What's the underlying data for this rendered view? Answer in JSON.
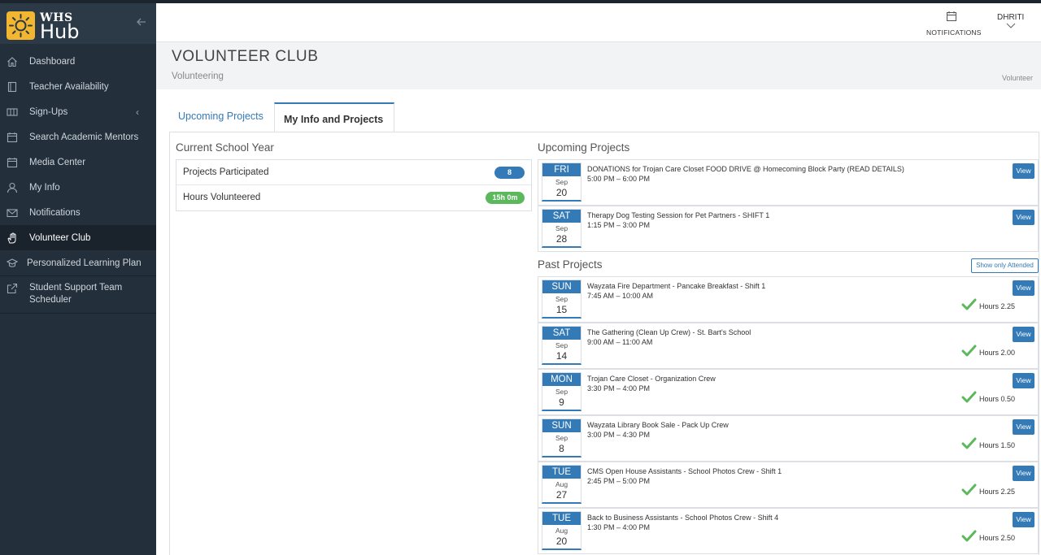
{
  "app": {
    "logo_top": "WHS",
    "logo_bottom": "Hub"
  },
  "sidebar": {
    "items": [
      {
        "label": "Dashboard",
        "icon": "home-icon"
      },
      {
        "label": "Teacher Availability",
        "icon": "book-icon"
      },
      {
        "label": "Sign-Ups",
        "icon": "columns-icon"
      },
      {
        "label": "Search Academic Mentors",
        "icon": "calendar-icon"
      },
      {
        "label": "Media Center",
        "icon": "calendar-icon"
      },
      {
        "label": "My Info",
        "icon": "user-icon"
      },
      {
        "label": "Notifications",
        "icon": "envelope-icon"
      },
      {
        "label": "Volunteer Club",
        "icon": "hand-icon"
      },
      {
        "label": "Personalized Learning Plan",
        "icon": "graduation-cap-icon"
      },
      {
        "label": "Student Support Team Scheduler",
        "icon": "external-link-icon"
      }
    ]
  },
  "header": {
    "notifications_label": "NOTIFICATIONS",
    "user_name": "DHRITI"
  },
  "page": {
    "title": "VOLUNTEER CLUB",
    "subtitle": "Volunteering",
    "breadcrumb": "Volunteer"
  },
  "tabs": [
    {
      "label": "Upcoming Projects"
    },
    {
      "label": "My Info and Projects"
    }
  ],
  "summary": {
    "title": "Current School Year",
    "rows": [
      {
        "label": "Projects Participated",
        "value": "8"
      },
      {
        "label": "Hours Volunteered",
        "value": "15h 0m"
      }
    ]
  },
  "upcoming": {
    "title": "Upcoming Projects",
    "items": [
      {
        "dow": "FRI",
        "mon": "Sep",
        "day": "20",
        "title": "DONATIONS for Trojan Care Closet FOOD DRIVE @ Homecoming Block Party (READ DETAILS)",
        "time": "5:00 PM – 6:00 PM",
        "view": "View"
      },
      {
        "dow": "SAT",
        "mon": "Sep",
        "day": "28",
        "title": "Therapy Dog Testing Session for Pet Partners - SHIFT 1",
        "time": "1:15 PM – 3:00 PM",
        "view": "View"
      }
    ]
  },
  "past": {
    "title": "Past Projects",
    "filter_label": "Show only Attended",
    "items": [
      {
        "dow": "SUN",
        "mon": "Sep",
        "day": "15",
        "title": "Wayzata Fire Department - Pancake Breakfast - Shift 1",
        "time": "7:45 AM – 10:00 AM",
        "hours": "Hours 2.25",
        "view": "View"
      },
      {
        "dow": "SAT",
        "mon": "Sep",
        "day": "14",
        "title": "The Gathering (Clean Up Crew) - St. Bart's School",
        "time": "9:00 AM – 11:00 AM",
        "hours": "Hours 2.00",
        "view": "View"
      },
      {
        "dow": "MON",
        "mon": "Sep",
        "day": "9",
        "title": "Trojan Care Closet - Organization Crew",
        "time": "3:30 PM – 4:00 PM",
        "hours": "Hours 0.50",
        "view": "View"
      },
      {
        "dow": "SUN",
        "mon": "Sep",
        "day": "8",
        "title": "Wayzata Library Book Sale - Pack Up Crew",
        "time": "3:00 PM – 4:30 PM",
        "hours": "Hours 1.50",
        "view": "View"
      },
      {
        "dow": "TUE",
        "mon": "Aug",
        "day": "27",
        "title": "CMS Open House Assistants - School Photos Crew - Shift 1",
        "time": "2:45 PM – 5:00 PM",
        "hours": "Hours 2.25",
        "view": "View"
      },
      {
        "dow": "TUE",
        "mon": "Aug",
        "day": "20",
        "title": "Back to Business Assistants - School Photos Crew - Shift 4",
        "time": "1:30 PM – 4:00 PM",
        "hours": "Hours 2.50",
        "view": "View"
      }
    ]
  },
  "colors": {
    "accent": "#337ab7",
    "sidebar": "#232f3b",
    "success": "#5cb85c",
    "brand": "#f2b630"
  }
}
